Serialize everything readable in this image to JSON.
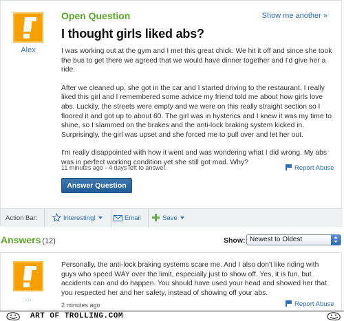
{
  "question": {
    "type_label": "Open Question",
    "show_another": "Show me another »",
    "title": "I thought girls liked abs?",
    "asker": "Alex",
    "paragraphs": [
      "I was working out at the gym and I met this great chick. We hit it off and since she took the bus to get there we agreed that we would have dinner together and I'd give her a ride.",
      "After we cleaned up, she got in the car and I started driving to the restaurant. I really liked this girl and I remembered some advice my friend told me about how girls love abs. Luckily, the streets were empty and we were on this really straight section so I floored it and got up to about 60. The girl was in hysterics and I knew it was my time to shine, so I slammed on the brakes and the anti-lock braking system kicked in. Surprisingly, the girl was upset and she forced me to pull over and let her out.",
      "I'm really disappointed with how it went and was wondering what I did wrong. My abs was in perfect working condition yet she still got mad. Why?"
    ],
    "meta": "11 minutes ago - 4 days left to answer.",
    "report_abuse": "Report Abuse",
    "answer_button": "Answer Question"
  },
  "action_bar": {
    "label": "Action Bar:",
    "interesting": "Interesting!",
    "email": "Email",
    "save": "Save"
  },
  "answers": {
    "heading": "Answers",
    "count": "(12)",
    "show_label": "Show:",
    "sort_selected": "Newest to Oldest",
    "items": [
      {
        "author": "...",
        "text": "Personally, the anti-lock braking systems scare me. And I also don't like riding with guys who speed WAY over the limit, especially just to show off. Yes, it is fun, but accidents can and do happen. You should have used your head and showed her that you respected her and her safety, instead of showing off your abs.",
        "meta": "2 minutes ago",
        "report_abuse": "Report Abuse"
      }
    ]
  },
  "watermark": {
    "text": "ART OF TROLLING.COM"
  },
  "colors": {
    "accent_green": "#5aa829",
    "link_blue": "#2f6fb6",
    "avatar_orange": "#f7a000",
    "button_blue": "#2a64a0"
  },
  "icons": {
    "avatar": "exclamation-avatar-icon",
    "report": "flag-icon",
    "interesting": "star-icon",
    "email": "envelope-icon",
    "save": "plus-icon",
    "sort": "up-down-arrows-icon"
  }
}
